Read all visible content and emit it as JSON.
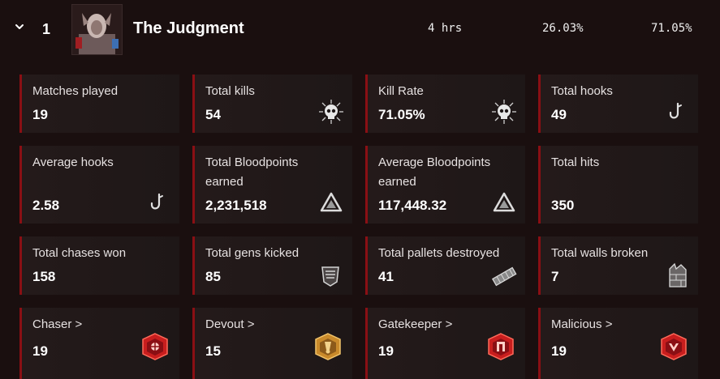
{
  "header": {
    "rank": "1",
    "killer_name": "The Judgment",
    "time_played": "4 hrs",
    "stat_a": "26.03%",
    "stat_b": "71.05%"
  },
  "colors": {
    "background": "#1a0f0f",
    "card": "#221919",
    "accent_red": "#8a0f14",
    "badge_red": "#c81e1e",
    "badge_gold": "#c98a2b"
  },
  "cards": [
    {
      "label": "Matches played",
      "value": "19",
      "icon": "none"
    },
    {
      "label": "Total kills",
      "value": "54",
      "icon": "skull-icon"
    },
    {
      "label": "Kill Rate",
      "value": "71.05%",
      "icon": "skull-icon"
    },
    {
      "label": "Total hooks",
      "value": "49",
      "icon": "hook-icon"
    },
    {
      "label": "Average hooks",
      "value": "2.58",
      "icon": "hook-icon"
    },
    {
      "label": "Total Bloodpoints earned",
      "value": "2,231,518",
      "icon": "bloodpoints-icon"
    },
    {
      "label": "Average Bloodpoints earned",
      "value": "117,448.32",
      "icon": "bloodpoints-icon"
    },
    {
      "label": "Total hits",
      "value": "350",
      "icon": "none"
    },
    {
      "label": "Total chases won",
      "value": "158",
      "icon": "none"
    },
    {
      "label": "Total gens kicked",
      "value": "85",
      "icon": "generator-icon"
    },
    {
      "label": "Total pallets destroyed",
      "value": "41",
      "icon": "pallet-icon"
    },
    {
      "label": "Total walls broken",
      "value": "7",
      "icon": "wall-icon"
    },
    {
      "label": "Chaser",
      "chevron": ">",
      "value": "19",
      "icon": "chaser-badge-icon"
    },
    {
      "label": "Devout",
      "chevron": ">",
      "value": "15",
      "icon": "devout-badge-icon"
    },
    {
      "label": "Gatekeeper",
      "chevron": ">",
      "value": "19",
      "icon": "gatekeeper-badge-icon"
    },
    {
      "label": "Malicious",
      "chevron": ">",
      "value": "19",
      "icon": "malicious-badge-icon"
    }
  ]
}
